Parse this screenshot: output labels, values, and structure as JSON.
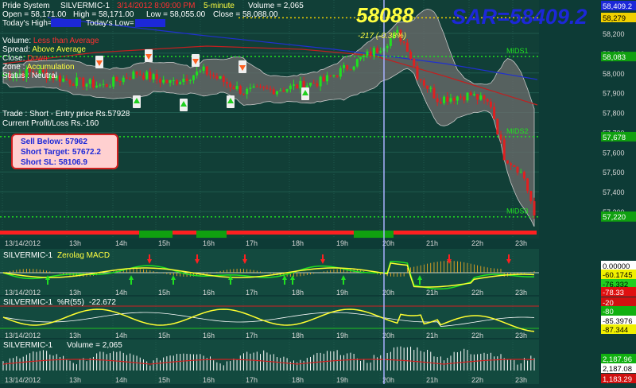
{
  "header": {
    "system": "Pride System",
    "symbol": "SILVERMIC-1",
    "datetime": "3/14/2012 8:09:00 PM",
    "interval": "5-minute",
    "volume_text": "Volume = 2,065",
    "open_text": "Open = 58,171.00",
    "high_text": "High = 58,171.00",
    "low_text": "Low = 58,055.00",
    "close_text": "Close = 58,088.00",
    "todays_high_label": "Today's High=",
    "todays_low_label": "Today's Low="
  },
  "big_price": "58088",
  "big_sar": "SAR=58409.2",
  "change_text": "-217  (-0.38%)",
  "status_lines": [
    {
      "label": "Volume: ",
      "value": "Less than Average",
      "color": "#ff3030"
    },
    {
      "label": "Spread: ",
      "value": "Above Average",
      "color": "#ffff40"
    },
    {
      "label": "Close: ",
      "value": "Down",
      "color": "#ff3030"
    },
    {
      "label": "Zone : ",
      "value": "Accumulation",
      "color": "#ffff40"
    },
    {
      "label": "Status : ",
      "value": "Neutral",
      "color": "#ffffff"
    }
  ],
  "trade_line1": "Trade : Short - Entry price Rs.57928",
  "trade_line2": "Current Profit/Loss Rs.-160",
  "signal_box": {
    "sell_below": "Sell Below: 57962",
    "short_target": "Short Target: 57672.2",
    "short_sl": "Short SL: 58106.9"
  },
  "level_labels": [
    "MIDS1",
    "MIDS2",
    "MIDS3"
  ],
  "price_axis": {
    "ticks": [
      "58,200",
      "58,100",
      "58,000",
      "57,900",
      "57,800",
      "57,700",
      "57,600",
      "57,500",
      "57,400",
      "57,300"
    ],
    "tags": [
      {
        "text": "58,409.2",
        "bg": "#1c28d8",
        "fg": "#ffffff",
        "value": 58409.2
      },
      {
        "text": "58,279",
        "bg": "#f0d000",
        "fg": "#000000",
        "value": 58279
      },
      {
        "text": "58,083",
        "bg": "#10a010",
        "fg": "#ffffff",
        "value": 58083
      },
      {
        "text": "57,678",
        "bg": "#10a010",
        "fg": "#ffffff",
        "value": 57678
      },
      {
        "text": "57,273",
        "bg": "#10a010",
        "fg": "#ffffff",
        "value": 57273
      },
      {
        "text": "57,220",
        "bg": "#10a010",
        "fg": "#ffffff",
        "value": 57220
      }
    ]
  },
  "time_labels": [
    "13/14/2012",
    "13h",
    "14h",
    "15h",
    "16h",
    "17h",
    "18h",
    "19h",
    "20h",
    "21h",
    "22h",
    "23h"
  ],
  "macd_panel": {
    "title": "SILVERMIC-1",
    "subtitle": "Zerolag MACD",
    "tags": [
      {
        "text": "0.00000",
        "bg": "#ffffff",
        "fg": "#000000"
      },
      {
        "text": "-60.1745",
        "bg": "#f0f000",
        "fg": "#000000"
      },
      {
        "text": "-76.332",
        "bg": "#20d020",
        "fg": "#000000"
      },
      {
        "text": "-78.33",
        "bg": "#e01010",
        "fg": "#ffffff"
      }
    ]
  },
  "wr_panel": {
    "title": "SILVERMIC-1",
    "subtitle": "%R(55)",
    "value": "-22.672",
    "tags": [
      {
        "text": "-20",
        "bg": "#d01010",
        "fg": "#ffffff"
      },
      {
        "text": "-80",
        "bg": "#10b010",
        "fg": "#ffffff"
      },
      {
        "text": "-85.3976",
        "bg": "#ffffff",
        "fg": "#000000"
      },
      {
        "text": "-87.344",
        "bg": "#f0f000",
        "fg": "#000000"
      }
    ]
  },
  "vol_panel": {
    "title": "SILVERMIC-1",
    "subtitle": "Volume = 2,065",
    "tags": [
      {
        "text": "2,187.96",
        "bg": "#10b010",
        "fg": "#ffffff"
      },
      {
        "text": "2,187.08",
        "bg": "#ffffff",
        "fg": "#000000"
      },
      {
        "text": "1,183.29",
        "bg": "#d01010",
        "fg": "#ffffff"
      }
    ]
  },
  "chart_data": {
    "type": "candlestick",
    "title": "SILVERMIC-1 5-minute",
    "x_labels": [
      "13h",
      "14h",
      "15h",
      "16h",
      "17h",
      "18h",
      "19h",
      "20h",
      "21h",
      "22h",
      "23h"
    ],
    "close_approx": [
      57990,
      58005,
      57960,
      57950,
      58010,
      57900,
      57920,
      57950,
      58030,
      58190,
      57870,
      57890,
      57820,
      57580,
      57530,
      57440,
      57250,
      58088
    ],
    "ylim": [
      57250,
      58250
    ],
    "levels": {
      "MIDS1": 58083,
      "MIDS2": 57678,
      "MIDS3": 57273
    },
    "last_close": 58088,
    "sar": 58409.2
  },
  "colors": {
    "background": "#0d3b36",
    "up_candle": "#20e020",
    "down_candle": "#e02020",
    "level_line": "#20e020",
    "band_fill": "#6a6a6a",
    "ma_blue": "#2030d0",
    "ma_red": "#c02020"
  }
}
